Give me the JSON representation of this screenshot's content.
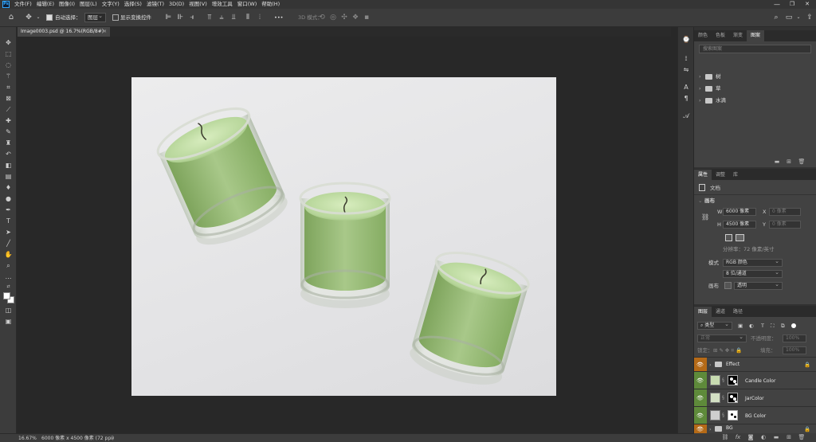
{
  "app": {
    "logo": "Ps"
  },
  "menubar": {
    "items": [
      "文件(F)",
      "编辑(E)",
      "图像(I)",
      "图层(L)",
      "文字(Y)",
      "选择(S)",
      "滤镜(T)",
      "3D(D)",
      "视图(V)",
      "增效工具",
      "窗口(W)",
      "帮助(H)"
    ],
    "minimize": "—",
    "maximize": "❐",
    "close": "✕"
  },
  "options": {
    "auto_select_label": "自动选择：",
    "auto_select_value": "图层",
    "transform_label": "显示变换控件",
    "more": "•••",
    "mode_3d": "3D 模式："
  },
  "document": {
    "tab_label": "Image0003.psd @ 16.7%(RGB/8#)",
    "tab_close": "×"
  },
  "status": {
    "zoom": "16.67%",
    "info": "6000 像素 x 4500 像素 (72 ppi)",
    "arrow": "›"
  },
  "swatches_panel": {
    "tabs": [
      "颜色",
      "色板",
      "渐变",
      "图案"
    ],
    "active_tab": "图案",
    "search_placeholder": "搜索图案",
    "groups": [
      {
        "name": "树"
      },
      {
        "name": "草"
      },
      {
        "name": "水滴"
      }
    ]
  },
  "properties_panel": {
    "tabs": [
      "属性",
      "调整",
      "库"
    ],
    "active_tab": "属性",
    "doc_label": "文档",
    "section_title": "画布",
    "width_label": "W",
    "width_value": "6000 像素",
    "height_label": "H",
    "height_value": "4500 像素",
    "x_label": "X",
    "y_label": "Y",
    "x_placeholder": "0 像素",
    "y_placeholder": "0 像素",
    "resolution": "分辨率：72 像素/英寸",
    "mode_label": "模式",
    "mode_value": "RGB 颜色",
    "depth_value": "8 位/通道",
    "bg_label": "画布",
    "bg_value": "透明"
  },
  "layers_panel": {
    "tabs": [
      "图层",
      "通道",
      "路径"
    ],
    "active_tab": "图层",
    "filter_label": "类型",
    "blend_mode": "正常",
    "opacity_label": "不透明度：",
    "opacity_value": "100%",
    "lock_label": "锁定：",
    "fill_label": "填充：",
    "fill_value": "100%",
    "layers": [
      {
        "name": "Effect",
        "type": "group",
        "eye_color": "#b56a17"
      },
      {
        "name": "Candle Color",
        "type": "pixel",
        "eye_color": "#5e8a3a",
        "thumb_color": "#c7dbb0"
      },
      {
        "name": "JarColor",
        "type": "pixel",
        "eye_color": "#5e8a3a",
        "thumb_color": "#d3e0c4"
      },
      {
        "name": "BG Color",
        "type": "pixel",
        "eye_color": "#5e8a3a",
        "thumb_color": "#cfcfcf"
      },
      {
        "name": "BG",
        "type": "group",
        "eye_color": "#b56a17"
      }
    ],
    "footer_icons": [
      "link-icon",
      "fx-icon",
      "mask-icon",
      "adjustment-icon",
      "folder-icon",
      "new-layer-icon",
      "trash-icon"
    ]
  },
  "colors": {
    "candle_wax": "#a9c98a",
    "candle_wax_dark": "#7fa860",
    "artboard": "#e7e7e9",
    "accent": "#31a8ff"
  }
}
